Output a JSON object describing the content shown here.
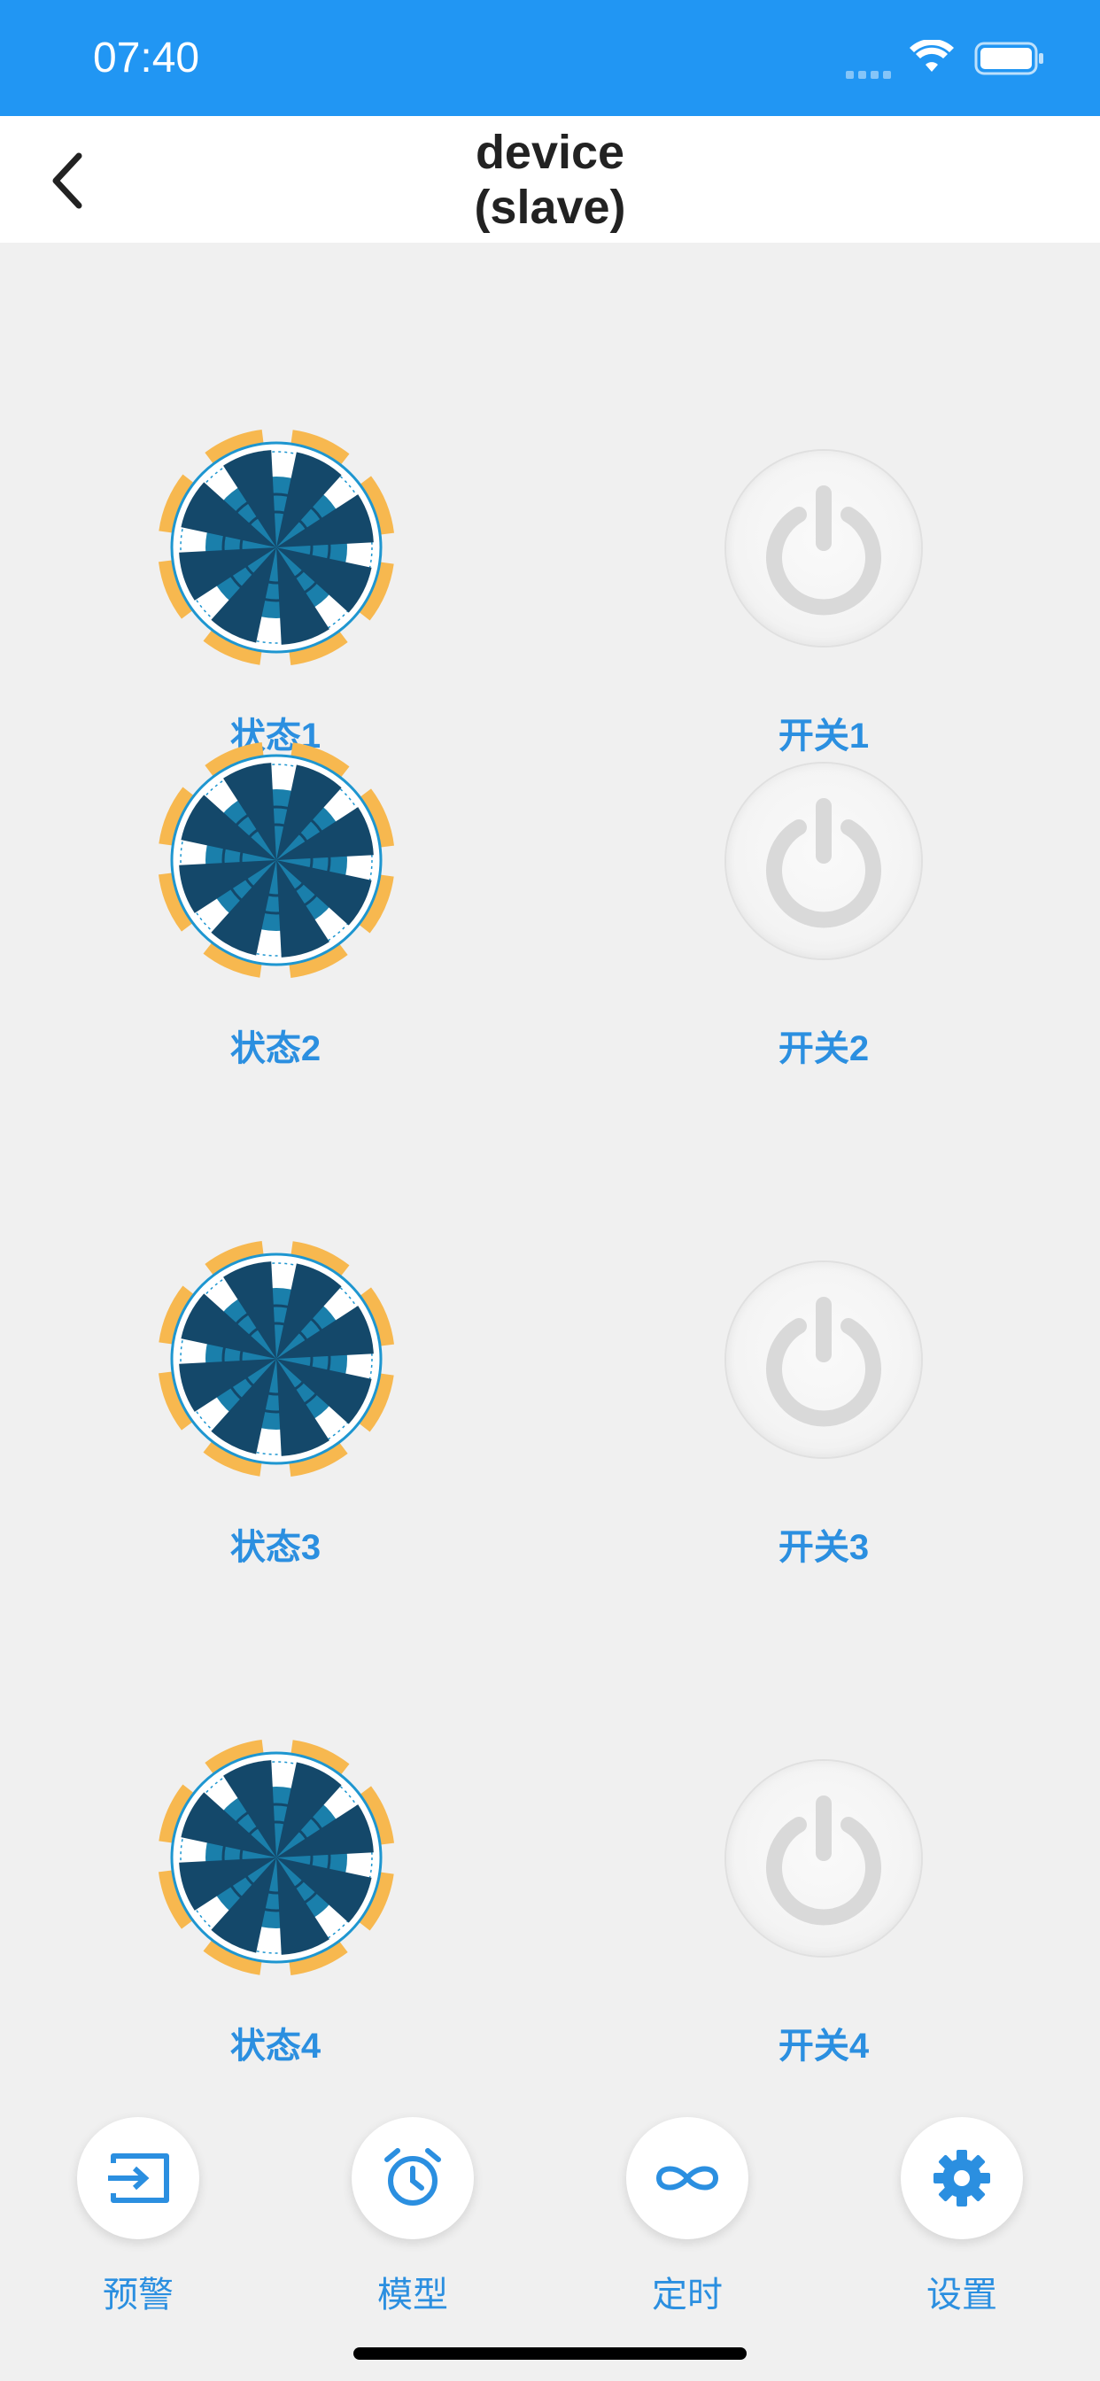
{
  "status_bar": {
    "time": "07:40"
  },
  "nav": {
    "title_line1": "device",
    "title_line2": "(slave)"
  },
  "rows": [
    {
      "status_label": "状态1",
      "switch_label": "开关1"
    },
    {
      "status_label": "状态2",
      "switch_label": "开关2"
    },
    {
      "status_label": "状态3",
      "switch_label": "开关3"
    },
    {
      "status_label": "状态4",
      "switch_label": "开关4"
    }
  ],
  "tabs": [
    {
      "label": "预警",
      "icon": "login-icon"
    },
    {
      "label": "模型",
      "icon": "alarm-clock-icon"
    },
    {
      "label": "定时",
      "icon": "infinity-icon"
    },
    {
      "label": "设置",
      "icon": "gear-icon"
    }
  ],
  "colors": {
    "primary": "#2196f3",
    "label_blue": "#2b8fe0",
    "petal_orange": "#f7b84f",
    "petal_dark": "#14486a",
    "petal_mid": "#1a7fab",
    "power_gray": "#d9d9d9"
  }
}
